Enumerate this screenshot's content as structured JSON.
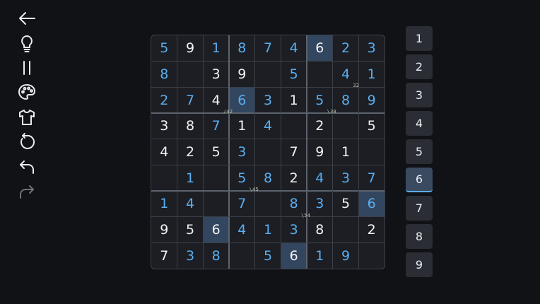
{
  "toolbar": [
    {
      "name": "back-icon",
      "enabled": true
    },
    {
      "name": "hint-icon",
      "enabled": true
    },
    {
      "name": "pause-icon",
      "enabled": true
    },
    {
      "name": "palette-icon",
      "enabled": true
    },
    {
      "name": "shirt-icon",
      "enabled": true
    },
    {
      "name": "restart-icon",
      "enabled": true
    },
    {
      "name": "undo-icon",
      "enabled": true
    },
    {
      "name": "redo-icon",
      "enabled": false
    }
  ],
  "board": {
    "rows": [
      [
        "5",
        "9",
        "1",
        "8",
        "7",
        "4",
        "6",
        "2",
        "3"
      ],
      [
        "8",
        "",
        "3",
        "9",
        "",
        "5",
        "",
        "4",
        "1"
      ],
      [
        "2",
        "7",
        "4",
        "6",
        "3",
        "1",
        "5",
        "8",
        "9"
      ],
      [
        "3",
        "8",
        "7",
        "1",
        "4",
        "",
        "2",
        "",
        "5"
      ],
      [
        "4",
        "2",
        "5",
        "3",
        "",
        "7",
        "9",
        "1",
        ""
      ],
      [
        "",
        "1",
        "",
        "5",
        "8",
        "2",
        "4",
        "3",
        "7"
      ],
      [
        "1",
        "4",
        "",
        "7",
        "",
        "8",
        "3",
        "5",
        "6"
      ],
      [
        "9",
        "5",
        "6",
        "4",
        "1",
        "3",
        "8",
        "",
        "2"
      ],
      [
        "7",
        "3",
        "8",
        "",
        "5",
        "6",
        "1",
        "9",
        ""
      ]
    ],
    "user_entered": [
      [
        1,
        0,
        1,
        1,
        1,
        1,
        0,
        1,
        1
      ],
      [
        1,
        0,
        0,
        0,
        0,
        1,
        0,
        1,
        1
      ],
      [
        1,
        1,
        0,
        1,
        1,
        0,
        1,
        1,
        1
      ],
      [
        0,
        0,
        1,
        0,
        1,
        0,
        0,
        0,
        0
      ],
      [
        0,
        0,
        0,
        1,
        0,
        0,
        0,
        0,
        0
      ],
      [
        0,
        1,
        0,
        1,
        1,
        0,
        1,
        1,
        1
      ],
      [
        1,
        1,
        0,
        1,
        0,
        1,
        1,
        0,
        1
      ],
      [
        0,
        0,
        0,
        1,
        1,
        1,
        0,
        0,
        0
      ],
      [
        0,
        1,
        1,
        0,
        1,
        0,
        1,
        1,
        0
      ]
    ],
    "highlighted": [
      [
        0,
        6
      ],
      [
        2,
        3
      ],
      [
        6,
        8
      ],
      [
        7,
        2
      ],
      [
        8,
        5
      ]
    ],
    "cage_labels": [
      {
        "text": "32",
        "row": 1,
        "col": 7
      },
      {
        "text": "/42",
        "row": 2,
        "col": 2
      },
      {
        "text": "\\38",
        "row": 2,
        "col": 6
      },
      {
        "text": "\\45",
        "row": 5,
        "col": 3
      },
      {
        "text": "\\54",
        "row": 6,
        "col": 5
      }
    ]
  },
  "numpad": {
    "digits": [
      "1",
      "2",
      "3",
      "4",
      "5",
      "6",
      "7",
      "8",
      "9"
    ],
    "selected": "6"
  },
  "colors": {
    "user_digit": "#5aaef0",
    "given_digit": "#f2f3f5",
    "highlight": "#33465f"
  }
}
